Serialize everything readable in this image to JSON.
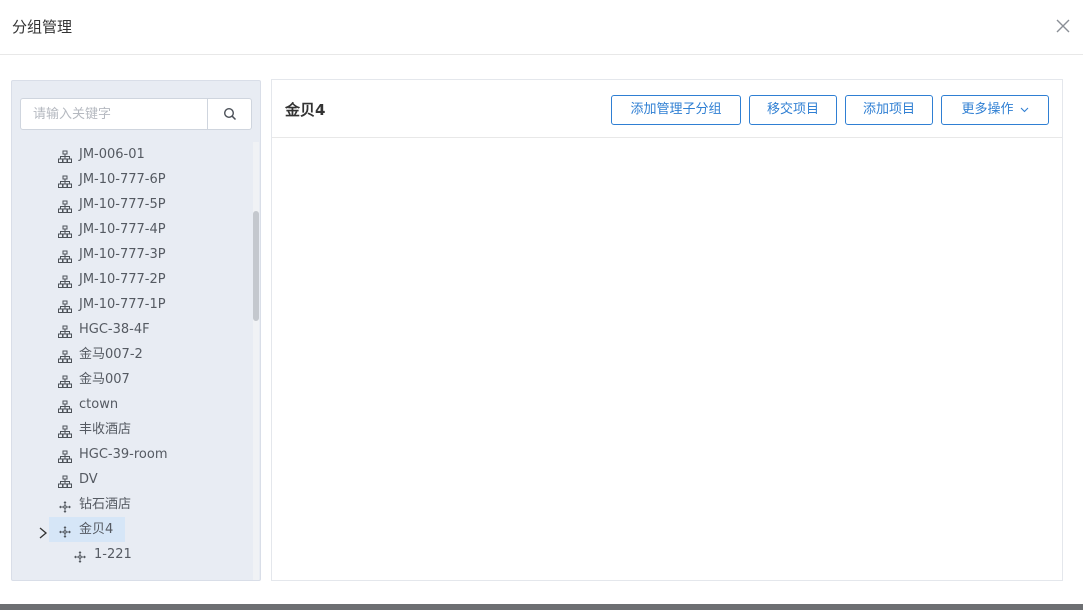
{
  "modal": {
    "title": "分组管理"
  },
  "tree": {
    "search_placeholder": "请输入关键字",
    "items": [
      {
        "label": "JM-006-01",
        "icon": "org-chart-icon"
      },
      {
        "label": "JM-10-777-6P",
        "icon": "org-chart-icon"
      },
      {
        "label": "JM-10-777-5P",
        "icon": "org-chart-icon"
      },
      {
        "label": "JM-10-777-4P",
        "icon": "org-chart-icon"
      },
      {
        "label": "JM-10-777-3P",
        "icon": "org-chart-icon"
      },
      {
        "label": "JM-10-777-2P",
        "icon": "org-chart-icon"
      },
      {
        "label": "JM-10-777-1P",
        "icon": "org-chart-icon"
      },
      {
        "label": "HGC-38-4F",
        "icon": "org-chart-icon"
      },
      {
        "label": "金马007-2",
        "icon": "org-chart-icon"
      },
      {
        "label": "金马007",
        "icon": "org-chart-icon"
      },
      {
        "label": "ctown",
        "icon": "org-chart-icon"
      },
      {
        "label": "丰收酒店",
        "icon": "org-chart-icon"
      },
      {
        "label": "HGC-39-room",
        "icon": "org-chart-icon"
      },
      {
        "label": "DV",
        "icon": "org-chart-icon"
      },
      {
        "label": "钻石酒店",
        "icon": "move-arrows-icon"
      },
      {
        "label": "金贝4",
        "icon": "move-arrows-icon",
        "selected": true,
        "expandable": true
      },
      {
        "label": "1-221",
        "icon": "move-arrows-icon",
        "child": true
      }
    ]
  },
  "detail": {
    "title": "金贝4",
    "buttons": {
      "add_sub_group": "添加管理子分组",
      "transfer_project": "移交项目",
      "add_project": "添加项目",
      "more_actions": "更多操作"
    }
  },
  "colors": {
    "accent": "#2f7fd3",
    "tree_bg": "#e8ecf3",
    "selected_bg": "#d6e6f7"
  }
}
